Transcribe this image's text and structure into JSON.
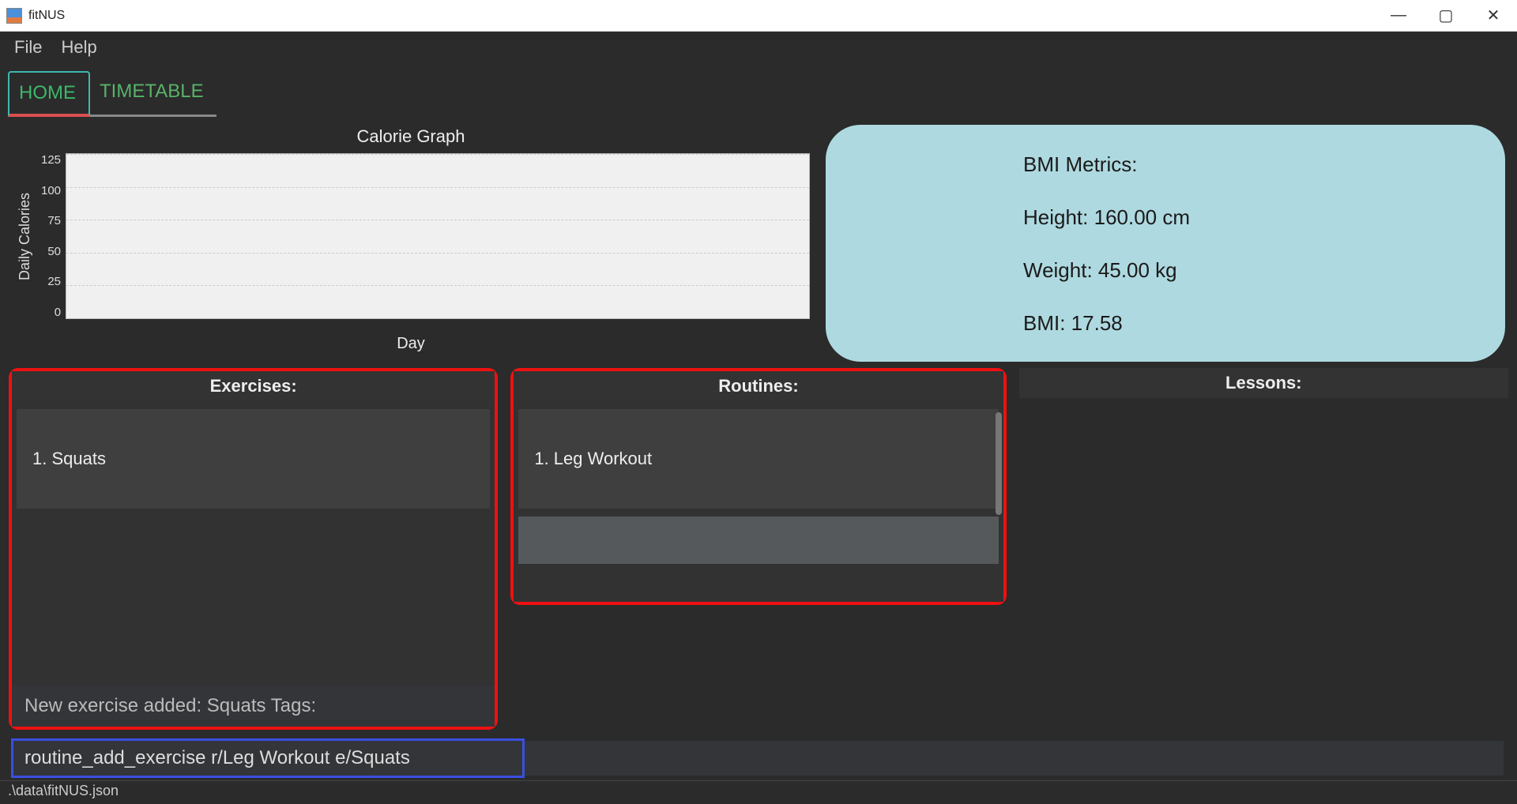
{
  "window": {
    "title": "fitNUS"
  },
  "menu": {
    "file": "File",
    "help": "Help"
  },
  "tabs": {
    "home": "HOME",
    "timetable": "TIMETABLE"
  },
  "chart": {
    "title": "Calorie Graph",
    "ylabel": "Daily Calories",
    "xlabel": "Day",
    "yticks": [
      "125",
      "100",
      "75",
      "50",
      "25",
      "0"
    ]
  },
  "chart_data": {
    "type": "bar",
    "title": "Calorie Graph",
    "xlabel": "Day",
    "ylabel": "Daily Calories",
    "categories": [],
    "values": [],
    "ylim": [
      0,
      125
    ]
  },
  "bmi": {
    "title": "BMI Metrics:",
    "height": "Height: 160.00 cm",
    "weight": "Weight: 45.00 kg",
    "bmi": "BMI: 17.58"
  },
  "panels": {
    "exercises": {
      "header": "Exercises:",
      "items": [
        "1.  Squats"
      ]
    },
    "routines": {
      "header": "Routines:",
      "items": [
        "1.  Leg Workout"
      ]
    },
    "lessons": {
      "header": "Lessons:"
    }
  },
  "feedback": "New exercise added: Squats Tags:",
  "command": {
    "value": "routine_add_exercise r/Leg Workout e/Squats"
  },
  "status": ".\\data\\fitNUS.json"
}
